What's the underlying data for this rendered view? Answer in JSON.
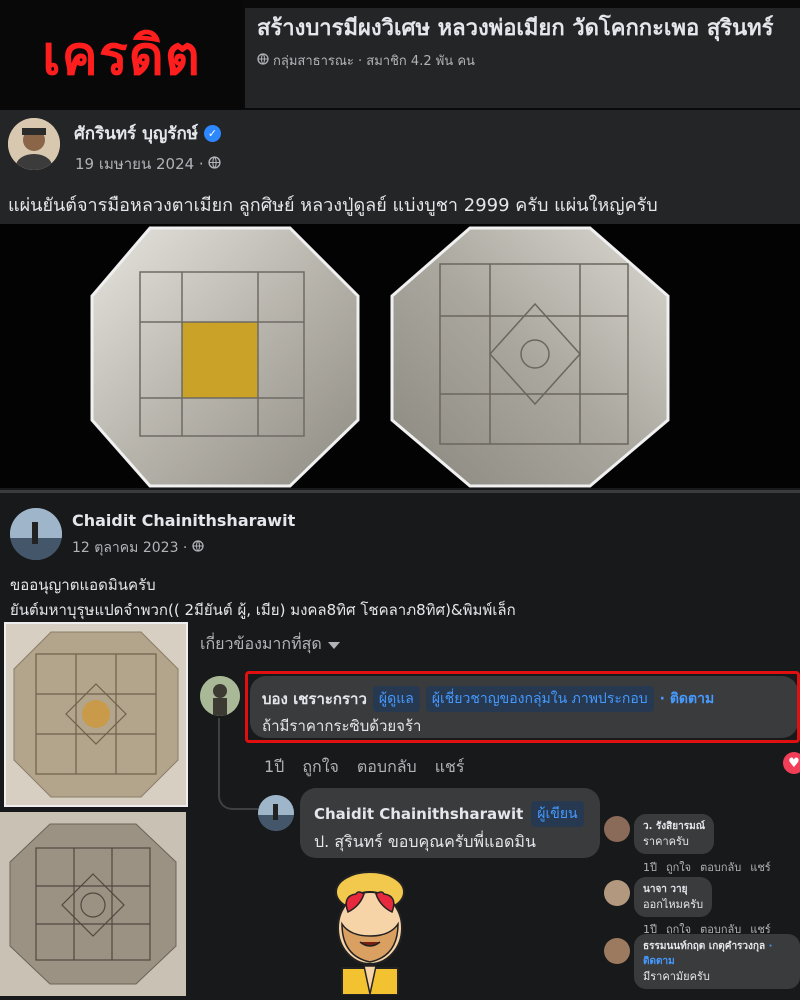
{
  "banner": {
    "credit_label": "เครดิต",
    "group_title": "สร้างบารมีผงวิเศษ หลวงพ่อเมียก วัดโคกกะเพอ สุรินทร์",
    "group_meta": "กลุ่มสาธารณะ · สมาชิก 4.2 พัน คน"
  },
  "post1": {
    "author": "ศักรินทร์ บุญรักษ์",
    "date": "19 เมษายน 2024 ·",
    "text": "แผ่นยันต์จารมือหลวงตาเมียก ลูกศิษย์ หลวงปู่ดูลย์ แบ่งบูชา 2999 ครับ แผ่นใหญ่ครับ"
  },
  "post2": {
    "author": "Chaidit Chainithsharawit",
    "date": "12 ตุลาคม 2023 ·",
    "line1": "ขออนุญาตแอดมินครับ",
    "line2": "ยันต์มหาบุรุษแปดจำพวก(( 2มียันต์ ผู้, เมีย) มงคล8ทิศ  โชคลาภ8ทิศ)&พิมพ์เล็ก"
  },
  "comments": {
    "sort_label": "เกี่ยวข้องมากที่สุด",
    "c1": {
      "name": "บอง เชราะกราว",
      "badge_admin": "ผู้ดูแล",
      "badge_expert": "ผู้เชี่ยวชาญของกลุ่มใน ภาพประกอบ",
      "follow": "· ติดตาม",
      "text": "ถ้ามีราคากระซิบด้วยจร้า",
      "time": "1ปี",
      "like": "ถูกใจ",
      "reply": "ตอบกลับ",
      "share": "แชร์"
    },
    "r1": {
      "name": "Chaidit Chainithsharawit",
      "badge_author": "ผู้เขียน",
      "text": "ป. สุรินทร์ ขอบคุณครับพี่แอดมิน"
    },
    "s1": {
      "name": "ว. รังสิยารมณ์",
      "text": "ราคาครับ",
      "time": "1ปี",
      "like": "ถูกใจ",
      "reply": "ตอบกลับ",
      "share": "แชร์"
    },
    "s2": {
      "name": "นาจา วายุ",
      "text": "ออกไหมครับ",
      "time": "1ปี",
      "like": "ถูกใจ",
      "reply": "ตอบกลับ",
      "share": "แชร์"
    },
    "s3": {
      "name": "ธรรมนนท์กฤต เกตุคำรวงกุล",
      "follow": "· ติดตาม",
      "text": "มีราคามัยครับ"
    }
  },
  "icons": {
    "globe": "globe-icon",
    "verified": "verified-badge-icon",
    "chevron": "chevron-down-icon",
    "heart": "heart-reaction-icon"
  },
  "colors": {
    "credit_red": "#ff1e1e",
    "link_blue": "#4599ff",
    "highlight_border": "#e01010"
  }
}
